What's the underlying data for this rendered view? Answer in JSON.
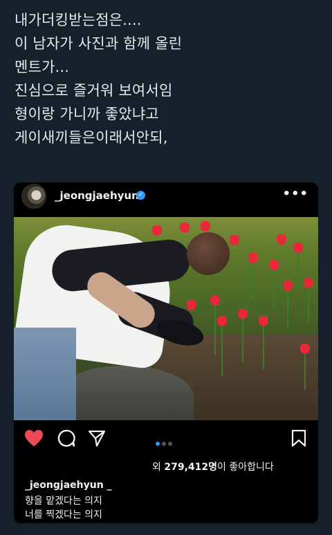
{
  "tweet": {
    "lines": [
      "내가더킹받는점은....",
      "이 남자가 사진과 함께 올린",
      "멘트가...",
      "진심으로 즐거워 보여서임",
      "형이랑 가니까 좋았냐고",
      "게이새끼들은이래서안되,"
    ]
  },
  "post": {
    "username": "_jeongjaehyun",
    "verified_icon": "verified-badge-icon",
    "more_icon": "more-dots-icon",
    "carousel": {
      "count": 3,
      "active": 1
    },
    "likes_prefix": "외",
    "likes_count": "279,412명",
    "likes_suffix": "이 좋아합니다",
    "caption_user": "_jeongjaehyun _",
    "caption_lines": [
      "향을 맡겠다는 의지",
      "너를 찍겠다는 의지"
    ]
  },
  "colors": {
    "background": "#15202b",
    "card": "#000000",
    "heart": "#ed4956",
    "verified": "#3897f0"
  }
}
